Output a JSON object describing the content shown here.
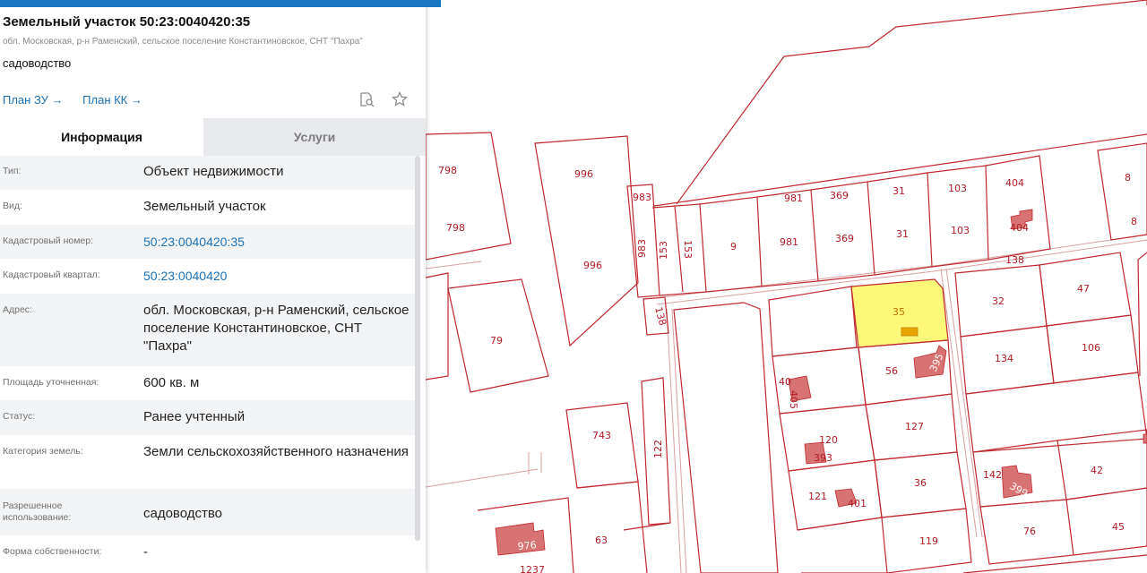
{
  "panel": {
    "title": "Земельный участок 50:23:0040420:35",
    "address_small": "обл. Московская, р-н Раменский, сельское поселение Константиновское, СНТ \"Пахра\"",
    "purpose": "садоводство",
    "links": {
      "plan_zu": "План ЗУ →",
      "plan_kk": "План КК →"
    },
    "tools": {
      "search_icon": "search-doc-icon",
      "star_icon": "star-icon"
    },
    "tabs": [
      {
        "label": "Информация",
        "active": true
      },
      {
        "label": "Услуги",
        "active": false
      }
    ],
    "rows": [
      {
        "key": "Тип:",
        "value": "Объект недвижимости"
      },
      {
        "key": "Вид:",
        "value": "Земельный участок"
      },
      {
        "key": "Кадастровый номер:",
        "value": "50:23:0040420:35"
      },
      {
        "key": "Кадастровый квартал:",
        "value": "50:23:0040420"
      },
      {
        "key": "Адрес:",
        "value": "обл. Московская, р-н Раменский, сельское поселение Константиновское, СНТ \"Пахра\""
      },
      {
        "key": "Площадь уточненная:",
        "value": "600 кв. м"
      },
      {
        "key": "Статус:",
        "value": "Ранее учтенный"
      },
      {
        "key": "Категория земель:",
        "value": "Земли сельскохозяйственного назначения"
      },
      {
        "key": "Разрешенное использование:",
        "value": "садоводство"
      },
      {
        "key": "Форма собственности:",
        "value": "-"
      }
    ],
    "colors": {
      "accent": "#1976c2",
      "link": "#1a72b8",
      "selected_parcel": "#fdf77a",
      "parcel_border": "#c0282e"
    }
  },
  "map": {
    "labels": [
      "798",
      "798",
      "996",
      "996",
      "983",
      "983",
      "153",
      "153",
      "9",
      "981",
      "981",
      "369",
      "369",
      "31",
      "31",
      "103",
      "103",
      "404",
      "404",
      "8",
      "8",
      "138",
      "138",
      "79",
      "35",
      "32",
      "47",
      "40",
      "405",
      "56",
      "395",
      "134",
      "106",
      "127",
      "120",
      "393",
      "743",
      "122",
      "142",
      "399",
      "36",
      "42",
      "121",
      "401",
      "76",
      "45",
      "976",
      "63",
      "119",
      "1237"
    ]
  }
}
